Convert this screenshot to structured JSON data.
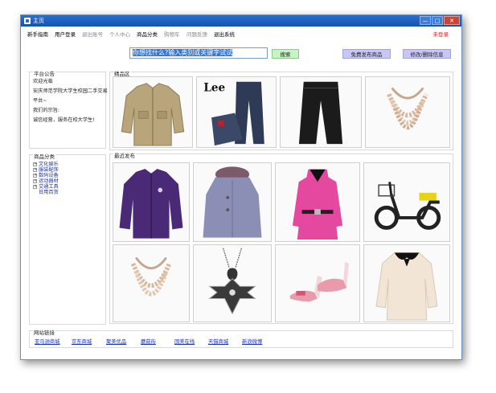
{
  "window": {
    "title": "主页",
    "controls": {
      "minimize": "—",
      "maximize": "□",
      "close": "✕"
    }
  },
  "menu": {
    "items": [
      {
        "label": "新手指南",
        "state": "active"
      },
      {
        "label": "用户登录",
        "state": "active"
      },
      {
        "label": "退出账号",
        "state": "disabled"
      },
      {
        "label": "个人中心",
        "state": "disabled"
      },
      {
        "label": "商品分类",
        "state": "active"
      },
      {
        "label": "购物车",
        "state": "disabled"
      },
      {
        "label": "问题反馈",
        "state": "disabled"
      },
      {
        "label": "退出系统",
        "state": "active"
      }
    ],
    "exit_label": "未登录"
  },
  "search": {
    "value": "你想找什么?输入类别或关键字试试",
    "button": "搜索",
    "post_button": "免费发布商品",
    "modify_button": "修改/删除信息"
  },
  "notice": {
    "title": "平台公告",
    "lines": [
      "欢迎光临",
      "安庆师范学院大学生校园二手交易",
      "平台~",
      "我们的宗旨:",
      "诚信经营，服务在校大学生!"
    ]
  },
  "categories": {
    "title": "商品分类",
    "items": [
      {
        "label": "文化娱乐",
        "expandable": true
      },
      {
        "label": "服装配饰",
        "expandable": true
      },
      {
        "label": "数码设备",
        "expandable": true
      },
      {
        "label": "运动器材",
        "expandable": true
      },
      {
        "label": "交通工具",
        "expandable": true
      },
      {
        "label": "日用百货",
        "expandable": false
      }
    ]
  },
  "featured": {
    "title": "精品区",
    "products": [
      {
        "type": "jacket",
        "color": "#b8a57c"
      },
      {
        "type": "jeans",
        "color": "#2f3a57",
        "brand": "Lee"
      },
      {
        "type": "pants",
        "color": "#1b1b1b"
      },
      {
        "type": "necklace",
        "color": "#d8b79d"
      }
    ]
  },
  "latest": {
    "title": "最近发布",
    "products": [
      {
        "type": "jacket",
        "color": "#4a2a77"
      },
      {
        "type": "coat",
        "color": "#8c8fb5"
      },
      {
        "type": "dress",
        "color": "#e5489f"
      },
      {
        "type": "scooter",
        "color": "#222222"
      },
      {
        "type": "necklace",
        "color": "#d8b79d"
      },
      {
        "type": "pendant",
        "color": "#555555"
      },
      {
        "type": "heels",
        "color": "#e89bab"
      },
      {
        "type": "blouse",
        "color": "#f2e5d6"
      }
    ]
  },
  "links": {
    "title": "网站链接",
    "items": [
      "亚马逊商城",
      "京东商城",
      "聚美优品",
      "蘑菇街",
      "国美在线",
      "天猫商城",
      "新浪微博"
    ]
  }
}
